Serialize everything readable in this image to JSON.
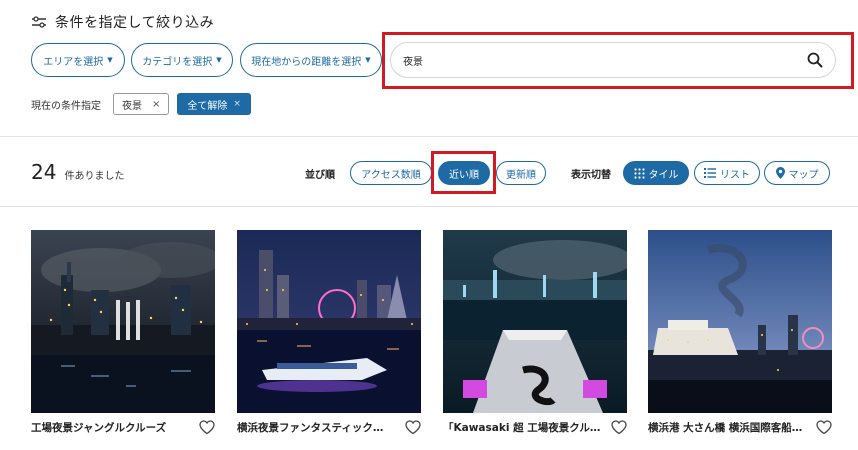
{
  "filter": {
    "title": "条件を指定して絞り込み",
    "area_label": "エリアを選択",
    "category_label": "カテゴリを選択",
    "distance_label": "現在地からの距離を選択",
    "search_value": "夜景",
    "current_label": "現在の条件指定",
    "chip_label": "夜景",
    "chip_close": "×",
    "clear_all_label": "全て解除",
    "clear_all_close": "×"
  },
  "results": {
    "count": "24",
    "count_suffix": "件ありました"
  },
  "sort": {
    "label": "並び順",
    "options": [
      "アクセス数順",
      "近い順",
      "更新順"
    ],
    "active": "近い順"
  },
  "view": {
    "label": "表示切替",
    "options": [
      "タイル",
      "リスト",
      "マップ"
    ],
    "active": "タイル"
  },
  "cards": [
    {
      "title": "工場夜景ジャングルクルーズ"
    },
    {
      "title": "横浜夜景ファンタスティック…"
    },
    {
      "title": "「Kawasaki 超 工場夜景クル…"
    },
    {
      "title": "横浜港 大さん橋 横浜国際客船…"
    }
  ],
  "colors": {
    "accent": "#1d6aa5",
    "highlight": "#d11a22"
  }
}
